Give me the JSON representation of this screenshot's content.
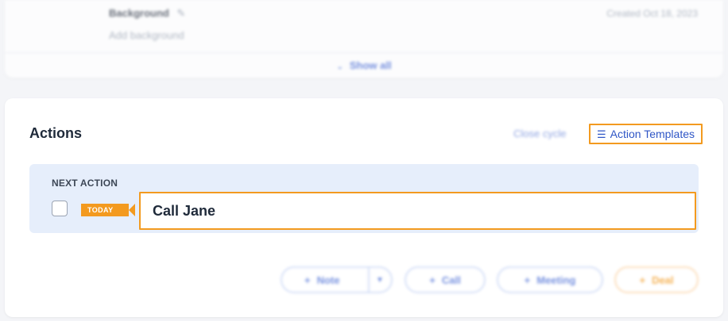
{
  "background_section": {
    "title": "Background",
    "created": "Created Oct 18, 2023",
    "add_placeholder": "Add background",
    "show_all": "Show all"
  },
  "actions": {
    "title": "Actions",
    "close_cycle": "Close cycle",
    "templates_label": "Action Templates",
    "next_label": "NEXT ACTION",
    "today_tag": "TODAY",
    "next_action_value": "Call Jane",
    "buttons": {
      "note": "Note",
      "call": "Call",
      "meeting": "Meeting",
      "deal": "Deal"
    }
  },
  "colors": {
    "highlight": "#f39a1f",
    "link": "#2f56c6",
    "panel": "#e6eefb"
  }
}
